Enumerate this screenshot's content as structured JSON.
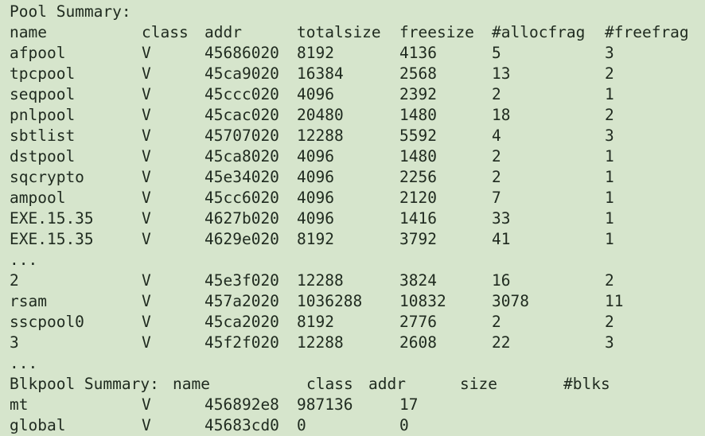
{
  "pool_summary_title": "Pool Summary:",
  "pool_headers": [
    "name",
    "class",
    "addr",
    "totalsize",
    "freesize",
    "#allocfrag",
    "#freefrag"
  ],
  "pool_rows": [
    [
      "afpool",
      "V",
      "45686020",
      "8192",
      "4136",
      "5",
      "3"
    ],
    [
      "tpcpool",
      "V",
      "45ca9020",
      "16384",
      "2568",
      "13",
      "2"
    ],
    [
      "seqpool",
      "V",
      "45ccc020",
      "4096",
      "2392",
      "2",
      "1"
    ],
    [
      "pnlpool",
      "V",
      "45cac020",
      "20480",
      "1480",
      "18",
      "2"
    ],
    [
      "sbtlist",
      "V",
      "45707020",
      "12288",
      "5592",
      "4",
      "3"
    ],
    [
      "dstpool",
      "V",
      "45ca8020",
      "4096",
      "1480",
      "2",
      "1"
    ],
    [
      "sqcrypto",
      "V",
      "45e34020",
      "4096",
      "2256",
      "2",
      "1"
    ],
    [
      "ampool",
      "V",
      "45cc6020",
      "4096",
      "2120",
      "7",
      "1"
    ],
    [
      "EXE.15.35",
      "V",
      "4627b020",
      "4096",
      "1416",
      "33",
      "1"
    ],
    [
      "EXE.15.35",
      "V",
      "4629e020",
      "8192",
      "3792",
      "41",
      "1"
    ]
  ],
  "ellipsis_1": "...",
  "pool_rows_2": [
    [
      "2",
      "V",
      "45e3f020",
      "12288",
      "3824",
      "16",
      "2"
    ],
    [
      "rsam",
      "V",
      "457a2020",
      "1036288",
      "10832",
      "3078",
      "11"
    ],
    [
      "sscpool0",
      "V",
      "45ca2020",
      "8192",
      "2776",
      "2",
      "2"
    ],
    [
      "3",
      "V",
      "45f2f020",
      "12288",
      "2608",
      "22",
      "3"
    ]
  ],
  "ellipsis_2": "...",
  "blkpool_title": "Blkpool Summary:",
  "blkpool_headers": [
    "name",
    "class",
    "addr",
    "size",
    "#blks"
  ],
  "blkpool_rows": [
    [
      "mt",
      "V",
      "456892e8",
      "987136",
      "17"
    ],
    [
      "global",
      "V",
      "45683cd0",
      "0",
      "0"
    ]
  ]
}
